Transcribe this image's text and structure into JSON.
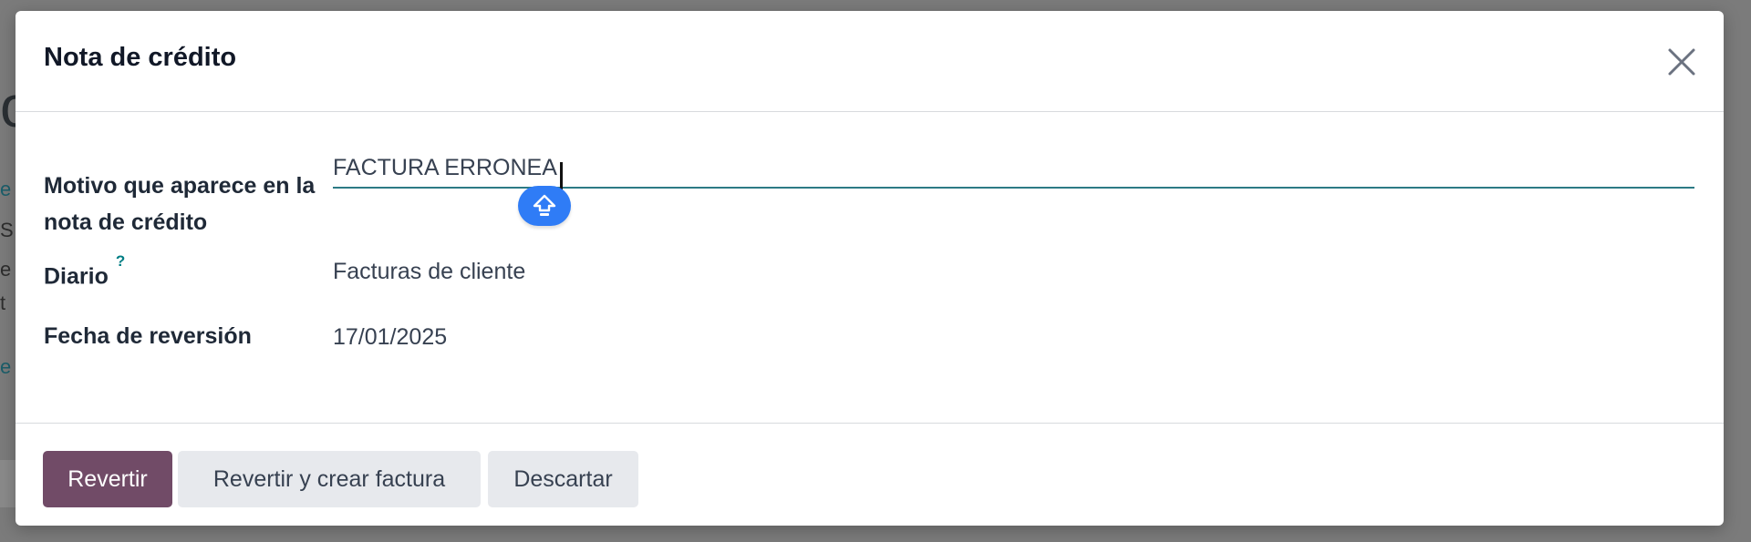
{
  "dialog": {
    "title": "Nota de crédito"
  },
  "form": {
    "reason": {
      "label": "Motivo que aparece en la nota de crédito",
      "value": "FACTURA ERRONEA"
    },
    "journal": {
      "label": "Diario",
      "help": "?",
      "value": "Facturas de cliente"
    },
    "date": {
      "label": "Fecha de reversión",
      "value": "17/01/2025"
    }
  },
  "footer": {
    "reverse_label": "Revertir",
    "reverse_and_create_label": "Revertir y crear factura",
    "discard_label": "Descartar"
  },
  "icons": {
    "close": "close-icon",
    "caps_lock": "caps-lock-icon"
  },
  "colors": {
    "primary": "#714b67",
    "secondary": "#e7e9ed",
    "input_underline": "#2c7a85",
    "caps_badge": "#2f7cf6",
    "help_mark": "#017e84",
    "backdrop": "#7b7b7b"
  }
}
